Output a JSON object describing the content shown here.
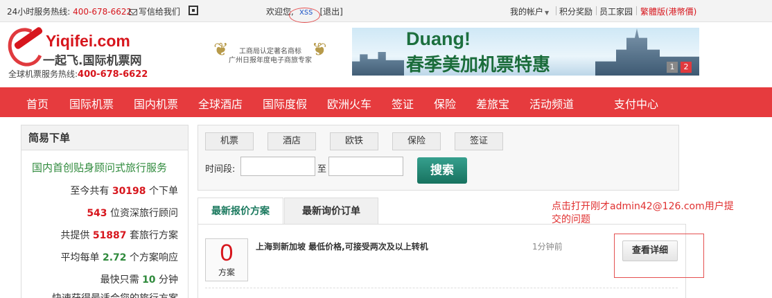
{
  "topbar": {
    "hotline_label": "24小时服务热线:",
    "hotline_number": "400-678-6622",
    "write_letter": "写信给我们",
    "welcome": "欢迎您,",
    "username": "xss",
    "logout": "[退出]",
    "my_account": "我的帐户",
    "points": "积分奖励",
    "staff_home": "员工家园",
    "traditional": "繁體版(港幣價)"
  },
  "header": {
    "logo_en": "Yiqifei.com",
    "logo_cn": "一起飞.国际机票网",
    "hotline_label": "全球机票服务热线:",
    "hotline_number": "400-678-6622",
    "award_line1": "工商局认定著名商标",
    "award_line2": "广州日报年度电子商旅专家",
    "banner_title": "Duang!",
    "banner_slogan": "春季美加机票特惠",
    "banner_page1": "1",
    "banner_page2": "2"
  },
  "nav": {
    "items": [
      "首页",
      "国际机票",
      "国内机票",
      "全球酒店",
      "国际度假",
      "欧洲火车",
      "签证",
      "保险",
      "差旅宝",
      "活动频道",
      "支付中心"
    ]
  },
  "quick_order": {
    "title": "简易下单",
    "slogan": "国内首创贴身顾问式旅行服务",
    "s1_pre": "至今共有",
    "s1_val": "30198",
    "s1_post": "个下单",
    "s2_val": "543",
    "s2_post": "位资深旅行顾问",
    "s3_pre": "共提供",
    "s3_val": "51887",
    "s3_post": "套旅行方案",
    "s4_pre": "平均每单",
    "s4_val": "2.72",
    "s4_post": "个方案响应",
    "s5_pre": "最快只需",
    "s5_val": "10",
    "s5_post": "分钟",
    "s6_text": "快速获得最适合您的旅行方案"
  },
  "search": {
    "tabs": [
      "机票",
      "酒店",
      "欧铁",
      "保险",
      "签证"
    ],
    "period_label": "时间段:",
    "to_label": "至",
    "button": "搜索"
  },
  "list_tabs": {
    "active": "最新报价方案",
    "inactive": "最新询价订单"
  },
  "listing": {
    "count": "0",
    "count_unit": "方案",
    "route": "上海到新加坡 最低价格,可接受两次及以上转机",
    "time": "1分钟前",
    "detail_button": "查看详细"
  },
  "annotation": {
    "text": "点击打开刚才admin42@126.com用户提交的问题"
  },
  "colors": {
    "brand_red": "#e63b3e",
    "accent_green": "#1c7a5f",
    "annotation_red": "#e03030"
  }
}
